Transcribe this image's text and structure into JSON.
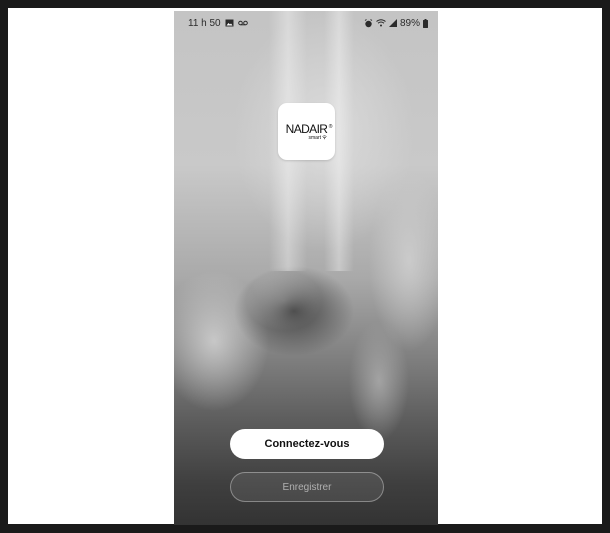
{
  "status_bar": {
    "time": "11 h 50",
    "battery": "89%",
    "icons": [
      "image-icon",
      "voicemail-icon",
      "alarm-icon",
      "wifi-icon",
      "signal-icon",
      "battery-icon"
    ]
  },
  "logo": {
    "brand": "NADAIR",
    "registered": "®",
    "sub": "smart"
  },
  "buttons": {
    "login_label": "Connectez-vous",
    "register_label": "Enregistrer"
  },
  "colors": {
    "login_bg": "#ffffff",
    "login_text": "#111111",
    "register_border": "#8a8a8a",
    "register_text": "#9a9a9a"
  }
}
